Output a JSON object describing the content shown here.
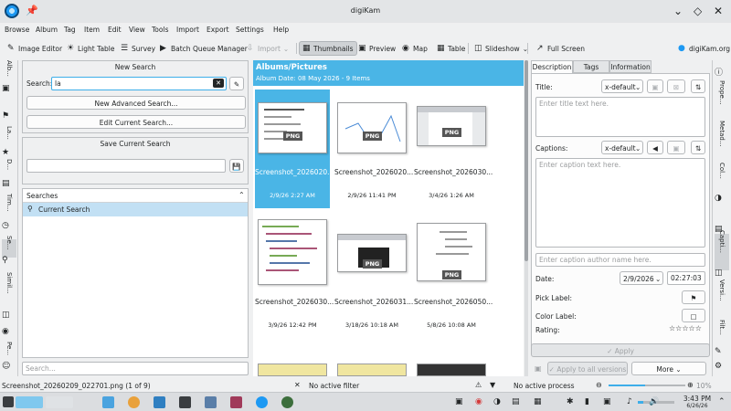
{
  "window": {
    "title": "digiKam"
  },
  "menu": [
    "Browse",
    "Album",
    "Tag",
    "Item",
    "Edit",
    "View",
    "Tools",
    "Import",
    "Export",
    "Settings",
    "Help"
  ],
  "toolbar": {
    "image_editor": "Image Editor",
    "light_table": "Light Table",
    "survey": "Survey",
    "batch_queue": "Batch Queue Manager",
    "import": "Import",
    "thumbnails": "Thumbnails",
    "preview": "Preview",
    "map": "Map",
    "table": "Table",
    "slideshow": "Slideshow",
    "full_screen": "Full Screen",
    "website": "digiKam.org"
  },
  "left_tabs": [
    "Alb...",
    "La...",
    "D...",
    "Tim...",
    "Se...",
    "Simil...",
    "Pe..."
  ],
  "search_panel": {
    "title": "New Search",
    "search_label": "Search:",
    "search_value": "la",
    "new_advanced": "New Advanced Search...",
    "edit_current": "Edit Current Search...",
    "save_title": "Save Current Search",
    "searches_header": "Searches",
    "current_search": "Current Search",
    "filter_placeholder": "Search..."
  },
  "album": {
    "title": "Albums/Pictures",
    "subtitle": "Album Date: 08 May 2026 - 9 Items",
    "badge": "PNG",
    "items": [
      {
        "name": "Screenshot_2026020...",
        "date": "2/9/26 2:27 AM"
      },
      {
        "name": "Screenshot_2026020...",
        "date": "2/9/26 11:41 PM"
      },
      {
        "name": "Screenshot_2026030...",
        "date": "3/4/26 1:26 AM"
      },
      {
        "name": "Screenshot_2026030...",
        "date": "3/9/26 12:42 PM"
      },
      {
        "name": "Screenshot_2026031...",
        "date": "3/18/26 10:18 AM"
      },
      {
        "name": "Screenshot_2026050...",
        "date": "5/8/26 10:08 AM"
      }
    ]
  },
  "properties": {
    "tabs": [
      "Description",
      "Tags",
      "Information"
    ],
    "title_label": "Title:",
    "lang": "x-default",
    "title_placeholder": "Enter title text here.",
    "captions_label": "Captions:",
    "caption_placeholder": "Enter caption text here.",
    "author_placeholder": "Enter caption author name here.",
    "date_label": "Date:",
    "date_value": "2/9/2026",
    "time_value": "02:27:03",
    "pick_label": "Pick Label:",
    "color_label": "Color Label:",
    "rating_label": "Rating:",
    "apply": "Apply",
    "apply_all": "Apply to all versions",
    "more": "More"
  },
  "right_tabs": [
    "Prope...",
    "Metad...",
    "Col...",
    "Capti...",
    "Versi...",
    "Filt..."
  ],
  "status": {
    "file": "Screenshot_20260209_022701.png (1 of 9)",
    "filter": "No active filter",
    "process": "No active process",
    "zoom": "10%"
  },
  "taskbar": {
    "time": "3:43 PM",
    "date": "6/26/26"
  }
}
